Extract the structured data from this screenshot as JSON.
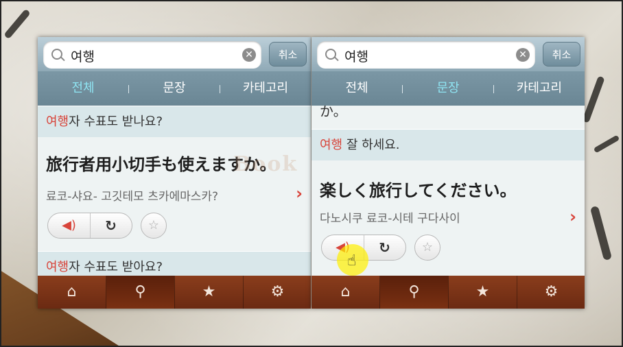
{
  "left": {
    "search": {
      "value": "여행",
      "cancel": "취소"
    },
    "tabs": [
      "전체",
      "문장",
      "카테고리"
    ],
    "group1": {
      "highlight": "여행",
      "rest": "자 수표도 받나요?"
    },
    "sentence": {
      "japanese": "旅行者用小切手も使えますか。",
      "pronunciation": "료코-샤요- 고깃테모 츠카에마스카?"
    },
    "group2": {
      "highlight": "여행",
      "rest": "자 수표도 받아요?"
    }
  },
  "right": {
    "search": {
      "value": "여행",
      "cancel": "취소"
    },
    "tabs": [
      "전체",
      "문장",
      "카테고리"
    ],
    "cut_text": "か。",
    "group1": {
      "highlight": "여행",
      "rest": " 잘 하세요."
    },
    "sentence": {
      "japanese": "楽しく旅行してください。",
      "pronunciation": "다노시쿠 료코-시테 구다사이"
    }
  },
  "watermark": "Book",
  "icons": {
    "search": "search-icon",
    "clear": "clear-icon",
    "chevron": "chevron-right-icon",
    "speaker": "speaker-icon",
    "refresh": "refresh-icon",
    "star": "star-icon",
    "home": "home-icon",
    "gear": "gear-icon",
    "cursor": "hand-cursor-icon"
  },
  "colors": {
    "accent": "#d8443a",
    "active_tab": "#8fe4f2",
    "bottom_bar": "#7a3314"
  }
}
